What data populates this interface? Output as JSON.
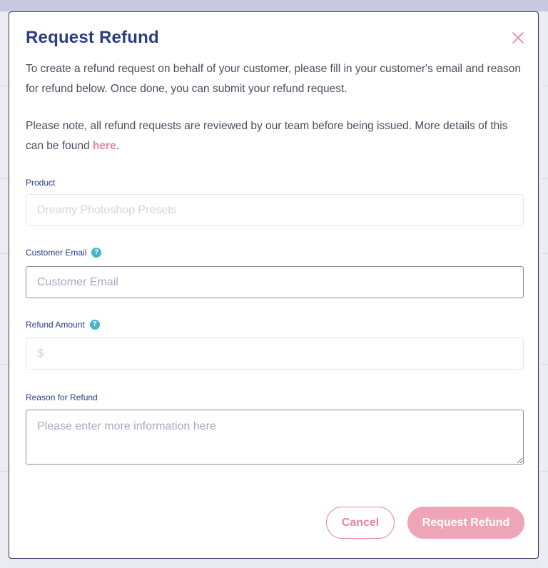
{
  "modal": {
    "title": "Request Refund",
    "intro_text": "To create a refund request on behalf of your customer, please fill in your customer's email and reason for refund below. Once done, you can submit your refund request.",
    "note_text": "Please note, all refund requests are reviewed by our team before being issued. More details of this can be found ",
    "note_link": "here",
    "note_end": "."
  },
  "form": {
    "product": {
      "label": "Product",
      "placeholder": "Dreamy Photoshop Presets"
    },
    "customer_email": {
      "label": "Customer Email",
      "placeholder": "Customer Email"
    },
    "refund_amount": {
      "label": "Refund Amount",
      "placeholder": "$"
    },
    "reason": {
      "label": "Reason for Refund",
      "placeholder": "Please enter more information here"
    },
    "help_icon_glyph": "?"
  },
  "buttons": {
    "cancel_label": "Cancel",
    "submit_label": "Request Refund"
  },
  "icons": {
    "close": "close-icon",
    "help": "question-mark-icon"
  },
  "colors": {
    "title": "#2e3c84",
    "accent_pink": "#e8849e",
    "submit_disabled": "#f0a4b7",
    "help_teal": "#43b7c3"
  }
}
